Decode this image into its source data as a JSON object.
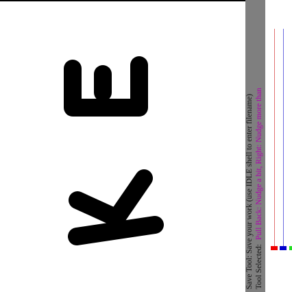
{
  "status": {
    "line1": "Save Tool: Save your work (use IDLE shell to enter filename)",
    "line2_label": "Tool Selected:",
    "line2_value": "Pull Back: Nudge a bit, Right: Nudge more than"
  },
  "colors": {
    "canvas": "#ffffff",
    "status_bar": "#7f7f7f",
    "highlight": "#b000b0",
    "stroke": "#000000",
    "palette": [
      "#ee0000",
      "#0000cc",
      "#22dd22"
    ]
  },
  "palette_icons": [
    "red-swatch",
    "blue-swatch",
    "green-swatch"
  ]
}
